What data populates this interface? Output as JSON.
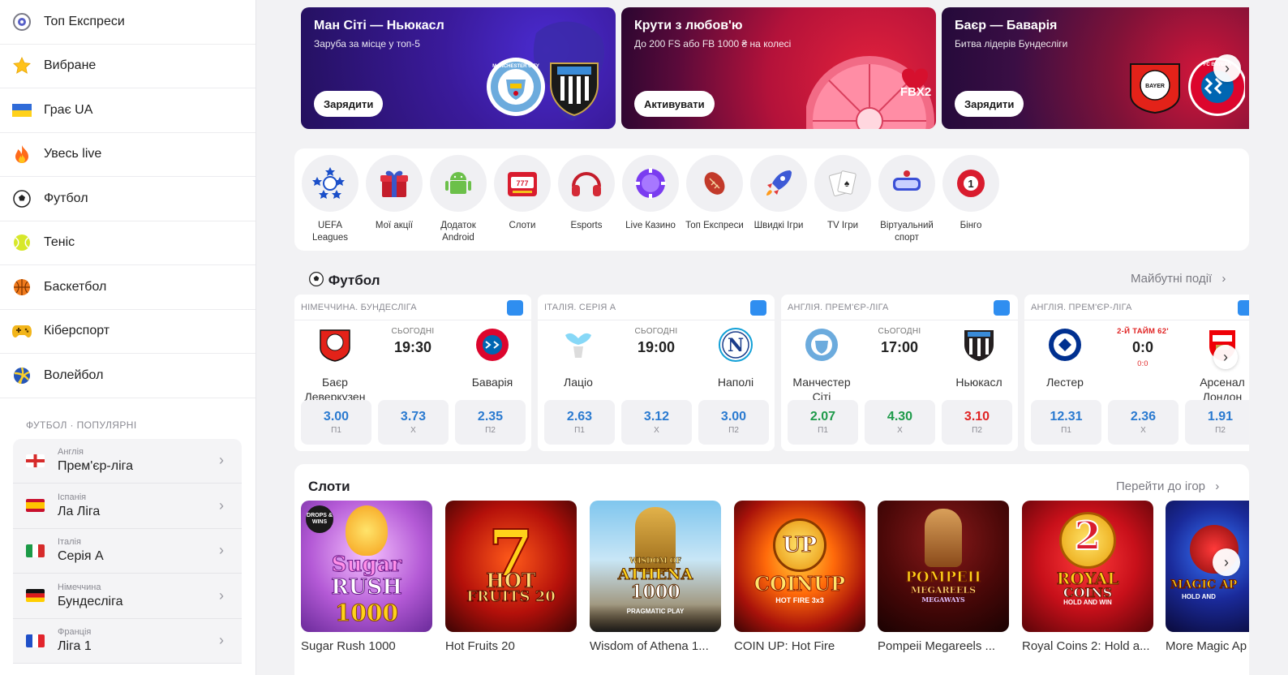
{
  "sidebar": {
    "items": [
      {
        "label": "Топ Експреси",
        "icon": "express-icon"
      },
      {
        "label": "Вибране",
        "icon": "star-icon"
      },
      {
        "label": "Грає UA",
        "icon": "ukraine-flag-icon"
      },
      {
        "label": "Увесь live",
        "icon": "fire-icon"
      },
      {
        "label": "Футбол",
        "icon": "soccer-ball-icon"
      },
      {
        "label": "Теніс",
        "icon": "tennis-ball-icon"
      },
      {
        "label": "Баскетбол",
        "icon": "basketball-icon"
      },
      {
        "label": "Кіберспорт",
        "icon": "gamepad-icon"
      },
      {
        "label": "Волейбол",
        "icon": "volleyball-icon"
      }
    ],
    "popular_title": "ФУТБОЛ · ПОПУЛЯРНІ",
    "leagues": [
      {
        "country": "Англія",
        "name": "Прем'єр-ліга"
      },
      {
        "country": "Іспанія",
        "name": "Ла Ліга"
      },
      {
        "country": "Італія",
        "name": "Серія А"
      },
      {
        "country": "Німеччина",
        "name": "Бундесліга"
      },
      {
        "country": "Франція",
        "name": "Ліга 1"
      }
    ]
  },
  "banners": [
    {
      "title": "Ман Сіті — Ньюкасл",
      "subtitle": "Заруба за місце у топ-5",
      "button": "Зарядити",
      "logo1_text": "MANCHESTER CITY"
    },
    {
      "title": "Крути з любов'ю",
      "subtitle": "До 200 FS або FB 1000 ₴ на колесі",
      "button": "Активувати",
      "wheel_text": "FBX2"
    },
    {
      "title": "Баєр — Баварія",
      "subtitle": "Битва лідерів Бундесліги",
      "button": "Зарядити",
      "logo1_text": "BAYER",
      "logo2_text": "FC BAYERN"
    }
  ],
  "categories": [
    {
      "label": "UEFA Leagues",
      "icon": "uefa-stars-icon"
    },
    {
      "label": "Мої акції",
      "icon": "gift-icon"
    },
    {
      "label": "Додаток Android",
      "icon": "android-icon"
    },
    {
      "label": "Слоти",
      "icon": "slot-machine-icon"
    },
    {
      "label": "Esports",
      "icon": "headphones-icon"
    },
    {
      "label": "Live Казино",
      "icon": "casino-chip-icon"
    },
    {
      "label": "Топ Експреси",
      "icon": "rugby-ball-icon"
    },
    {
      "label": "Швидкі Ігри",
      "icon": "rocket-icon"
    },
    {
      "label": "TV Ігри",
      "icon": "playing-cards-icon"
    },
    {
      "label": "Віртуальний спорт",
      "icon": "vr-headset-icon"
    },
    {
      "label": "Бінго",
      "icon": "bingo-ball-icon"
    }
  ],
  "bingo_number": "1",
  "football": {
    "title": "Футбол",
    "link": "Майбутні події",
    "matches": [
      {
        "league": "НІМЕЧЧИНА. БУНДЕСЛІГА",
        "day": "СЬОГОДНІ",
        "time": "19:30",
        "home": "Баєр Леверкузен",
        "away": "Баварія",
        "home_color": "#e32219",
        "away_color": "#dc052d",
        "odds": [
          {
            "v": "3.00",
            "l": "П1"
          },
          {
            "v": "3.73",
            "l": "Х"
          },
          {
            "v": "2.35",
            "l": "П2"
          }
        ]
      },
      {
        "league": "ІТАЛІЯ. СЕРІЯ А",
        "day": "СЬОГОДНІ",
        "time": "19:00",
        "home": "Лаціо",
        "away": "Наполі",
        "home_color": "#87d8f7",
        "away_color": "#12a0d7",
        "away_letter": "N",
        "odds": [
          {
            "v": "2.63",
            "l": "П1"
          },
          {
            "v": "3.12",
            "l": "Х"
          },
          {
            "v": "3.00",
            "l": "П2"
          }
        ]
      },
      {
        "league": "АНГЛІЯ. ПРЕМ'ЄР-ЛІГА",
        "day": "СЬОГОДНІ",
        "time": "17:00",
        "home": "Манчестер Сіті",
        "away": "Ньюкасл",
        "home_color": "#6cabdd",
        "away_color": "#241f20",
        "odds": [
          {
            "v": "2.07",
            "l": "П1",
            "c": "#1e9a4a"
          },
          {
            "v": "4.30",
            "l": "Х",
            "c": "#1e9a4a"
          },
          {
            "v": "3.10",
            "l": "П2",
            "c": "#e02424"
          }
        ]
      },
      {
        "league": "АНГЛІЯ. ПРЕМ'ЄР-ЛІГА",
        "live_status": "2-Й ТАЙМ 62'",
        "score": "0:0",
        "half_score": "0:0",
        "home": "Лестер",
        "away": "Арсенал Лондон",
        "home_color": "#003090",
        "away_color": "#ef0107",
        "odds": [
          {
            "v": "12.31",
            "l": "П1"
          },
          {
            "v": "2.36",
            "l": "Х"
          },
          {
            "v": "1.91",
            "l": "П2"
          }
        ]
      }
    ]
  },
  "slots": {
    "title": "Слоти",
    "link": "Перейти до ігор",
    "games": [
      {
        "name": "Sugar Rush 1000",
        "art1": "Sugar",
        "art2": "RUSH",
        "art3": "1000",
        "badge": "DROPS & WINS"
      },
      {
        "name": "Hot Fruits 20",
        "art1": "7",
        "art2": "HOT",
        "art3": "FRUITS 20"
      },
      {
        "name": "Wisdom of Athena 1...",
        "art1": "WISDOM OF",
        "art2": "ATHENA",
        "art3": "1000",
        "art4": "PRAGMATIC PLAY"
      },
      {
        "name": "COIN UP: Hot Fire",
        "art1": "UP",
        "art2": "COINUP",
        "art3": "HOT FIRE 3x3"
      },
      {
        "name": "Pompeii Megareels ...",
        "art1": "POMPEII",
        "art2": "MEGAREELS",
        "art3": "MEGAWAYS"
      },
      {
        "name": "Royal Coins 2: Hold a...",
        "art1": "2",
        "art2": "ROYAL",
        "art3": "COINS",
        "art4": "HOLD AND WIN"
      },
      {
        "name": "More Magic Ap",
        "art1": "MAGIC AP",
        "art2": "HOLD AND"
      }
    ]
  }
}
